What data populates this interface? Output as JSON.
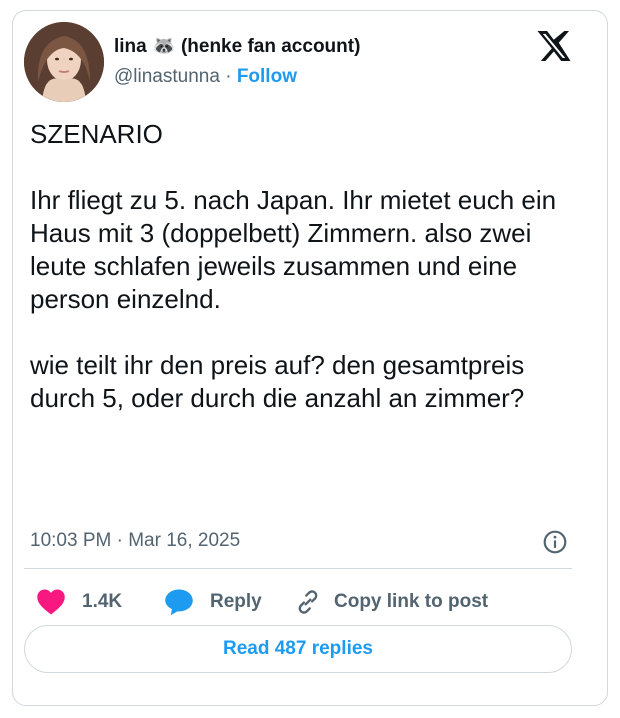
{
  "author": {
    "name": "lina 🦝 (henke fan account)",
    "handle": "@linastunna",
    "separator": "·",
    "follow_label": "Follow"
  },
  "tweet": {
    "text": "SZENARIO\n\nIhr fliegt zu 5. nach Japan. Ihr mietet euch ein Haus mit 3 (doppelbett) Zimmern. also zwei leute schlafen jeweils zusammen und eine person einzelnd.\n\nwie teilt ihr den preis auf? den gesamtpreis durch 5, oder durch die anzahl an zimmer?",
    "timestamp": "10:03 PM · Mar 16, 2025"
  },
  "actions": {
    "likes": "1.4K",
    "reply_label": "Reply",
    "copy_label": "Copy link to post"
  },
  "read_replies_label": "Read 487 replies",
  "icons": {
    "brand": "x-logo-icon",
    "info": "info-icon",
    "like": "heart-icon",
    "reply": "chat-bubble-icon",
    "copy": "link-icon"
  },
  "colors": {
    "accent": "#1d9bf0",
    "heart": "#f91880",
    "text": "#0f1419",
    "muted": "#536471",
    "border": "#cfd9de"
  }
}
